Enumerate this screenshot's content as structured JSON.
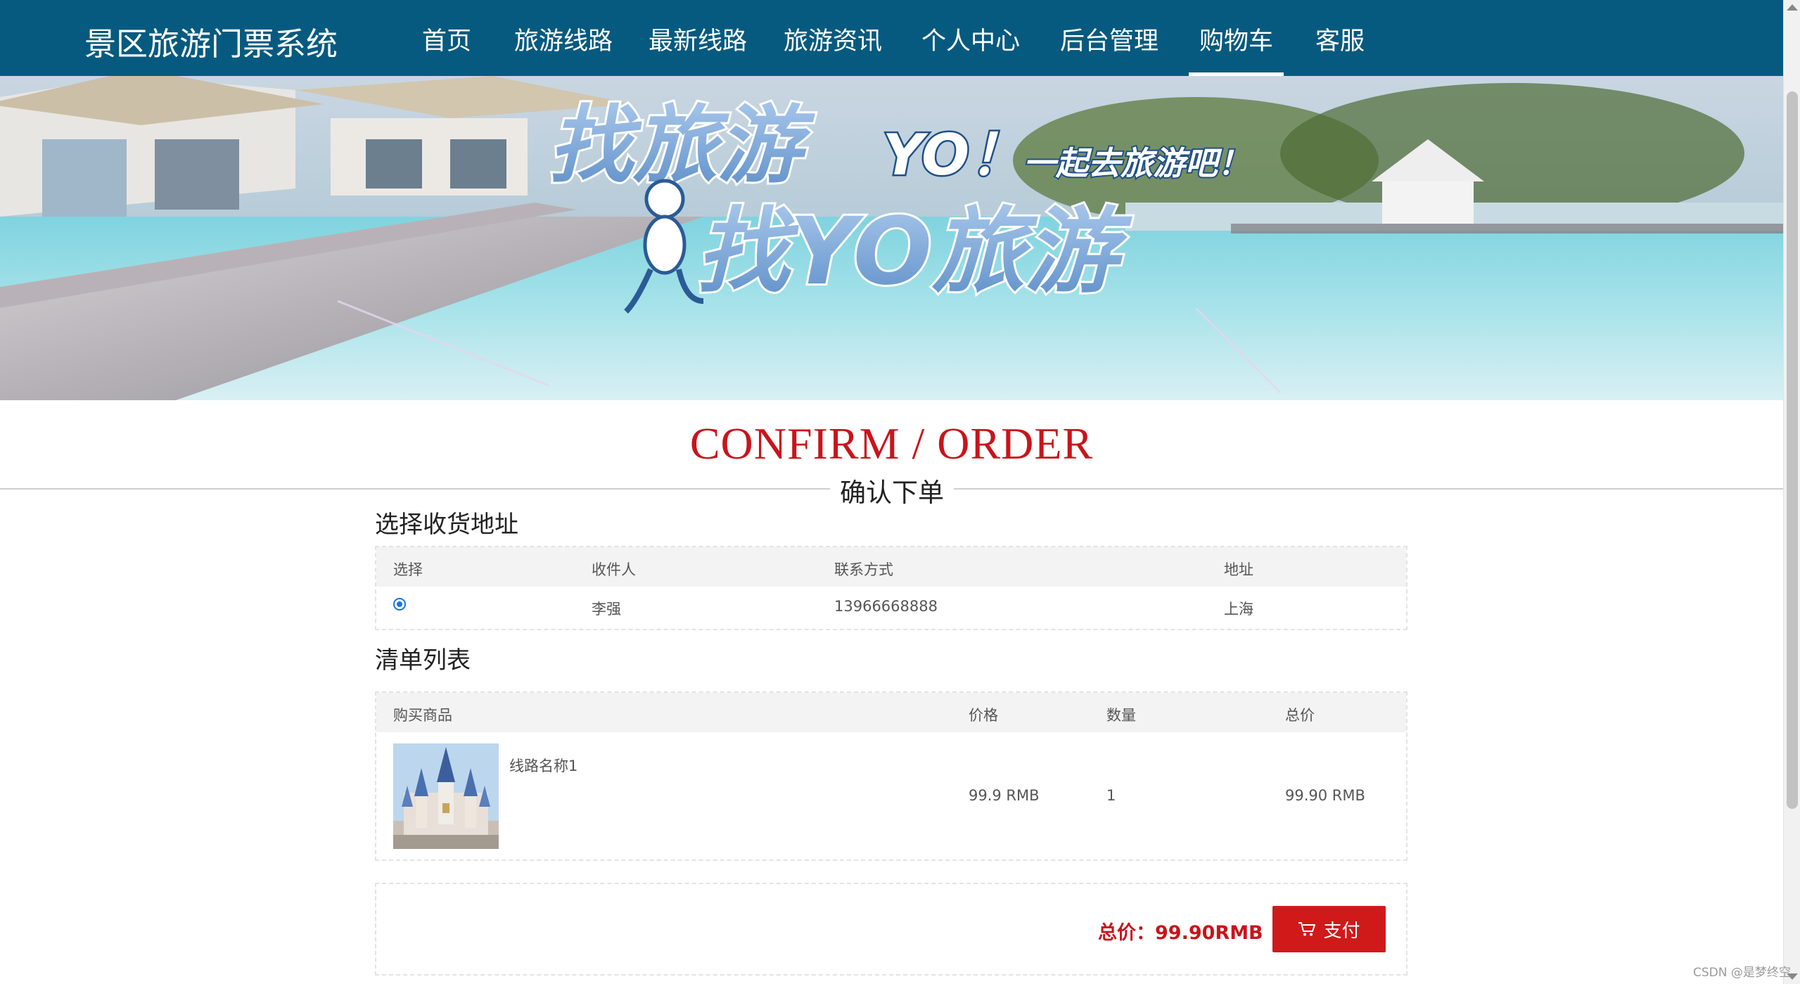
{
  "brand": {
    "title": "景区旅游门票系统"
  },
  "nav": {
    "items": [
      {
        "label": "首页"
      },
      {
        "label": "旅游线路"
      },
      {
        "label": "最新线路"
      },
      {
        "label": "旅游资讯"
      },
      {
        "label": "个人中心"
      },
      {
        "label": "后台管理"
      },
      {
        "label": "购物车",
        "active": true
      },
      {
        "label": "客服"
      }
    ]
  },
  "banner": {
    "line1": "找旅游",
    "line1_suffix": "YO！",
    "slogan": "一起去旅游吧！",
    "line2": "找YO旅游"
  },
  "heading": {
    "title": "CONFIRM / ORDER",
    "subtitle": "确认下单"
  },
  "address": {
    "section_title": "选择收货地址",
    "columns": [
      "选择",
      "收件人",
      "联系方式",
      "地址"
    ],
    "rows": [
      {
        "selected": true,
        "recipient": "李强",
        "phone": "13966668888",
        "address": "上海"
      }
    ]
  },
  "items": {
    "section_title": "清单列表",
    "columns": [
      "购买商品",
      "价格",
      "数量",
      "总价"
    ],
    "rows": [
      {
        "name": "线路名称1",
        "price": "99.9 RMB",
        "quantity": "1",
        "total": "99.90 RMB",
        "image_icon": "castle-thumbnail"
      }
    ]
  },
  "summary": {
    "total_label": "总价：99.90RMB",
    "pay_label": "支付",
    "pay_icon": "cart-icon"
  },
  "watermark": "CSDN @是梦终空",
  "colors": {
    "navbar": "#075a7f",
    "accent_red": "#c9141b",
    "pay_button": "#d01a1a"
  }
}
